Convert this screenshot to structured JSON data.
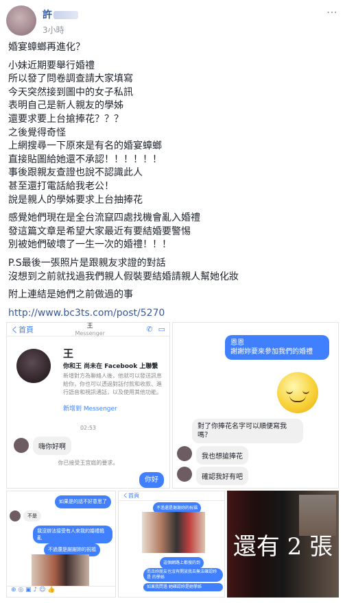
{
  "post": {
    "author_visible": "許",
    "timestamp": "3小時",
    "more_icon": "⋯",
    "paragraphs": [
      [
        "婚宴蟑螂再進化？"
      ],
      [
        "小妹近期要舉行婚禮",
        "所以發了問卷調查請大家填寫",
        "今天突然接到圖中的女子私訊",
        "表明自己是新人親友的學姊",
        "還要求要上台搶捧花？？？",
        "之後覺得奇怪",
        "上網搜尋一下原來是有名的婚宴蟑螂",
        "直接貼圖給她還不承認！！！！！！",
        "事後跟親友查證也說不認識此人",
        "甚至還打電話給我老公！",
        "說是親人的學姊要求上台抽捧花"
      ],
      [
        "感覺她們現在是全台流竄四處找機會亂入婚禮",
        "發這篇文章是希望大家最近有要結婚要警惕",
        "別被她們破壞了一生一次的婚禮！！！"
      ],
      [
        "P.S最後一張照片是跟親友求證的對話",
        "沒想到之前就找過我們親人假裝要結婚請親人幫她化妝"
      ],
      [
        "附上連結是她們之前做過的事"
      ]
    ],
    "link": "http://www.bc3ts.com/post/5270"
  },
  "photos": {
    "messenger1": {
      "back_label": "く首頁",
      "contact_initial": "王",
      "header_sub": "Messenger",
      "friend_line": "你和王 尚未在 Facebook 上聯繫",
      "notice": "新增對方為聯絡人後，他就可以發送訊息給你，你也可以透過對話付款和收款、進行語音和視訊通話，以及使用其他功能。",
      "add_link": "新增到 Messenger",
      "time": "02:53",
      "greeting": "嗨你好啊",
      "accept_note": "你已接受王宜庭的要求。",
      "reply": "你好"
    },
    "messenger2": {
      "msg1": "恩恩\n謝謝妳要來參加我們的婚禮",
      "msg2": "對了你捧花名字可以順便寫我嗎？",
      "reply1": "我也想搶捧花",
      "reply2": "確認我好有吧"
    },
    "messenger3": {
      "bubble1": "如果是的話不好意思了",
      "name_tag": "不是",
      "bubble2": "我沒辦法接受有人來我的婚禮搗亂",
      "bubble3": "不過還是謝謝妳的祝福"
    },
    "messenger4": {
      "back_label": "く首頁",
      "bubble1": "不過還是謝謝妳的祝福",
      "bubble2": "這個網路上都搜的到",
      "bubble3": "而且妳朋友也沒有開放我去無法確認妳是 的學姊",
      "bubble4": "如果我問過 她確認妳是她學姊"
    },
    "more_overlay": "還有 2 張"
  }
}
